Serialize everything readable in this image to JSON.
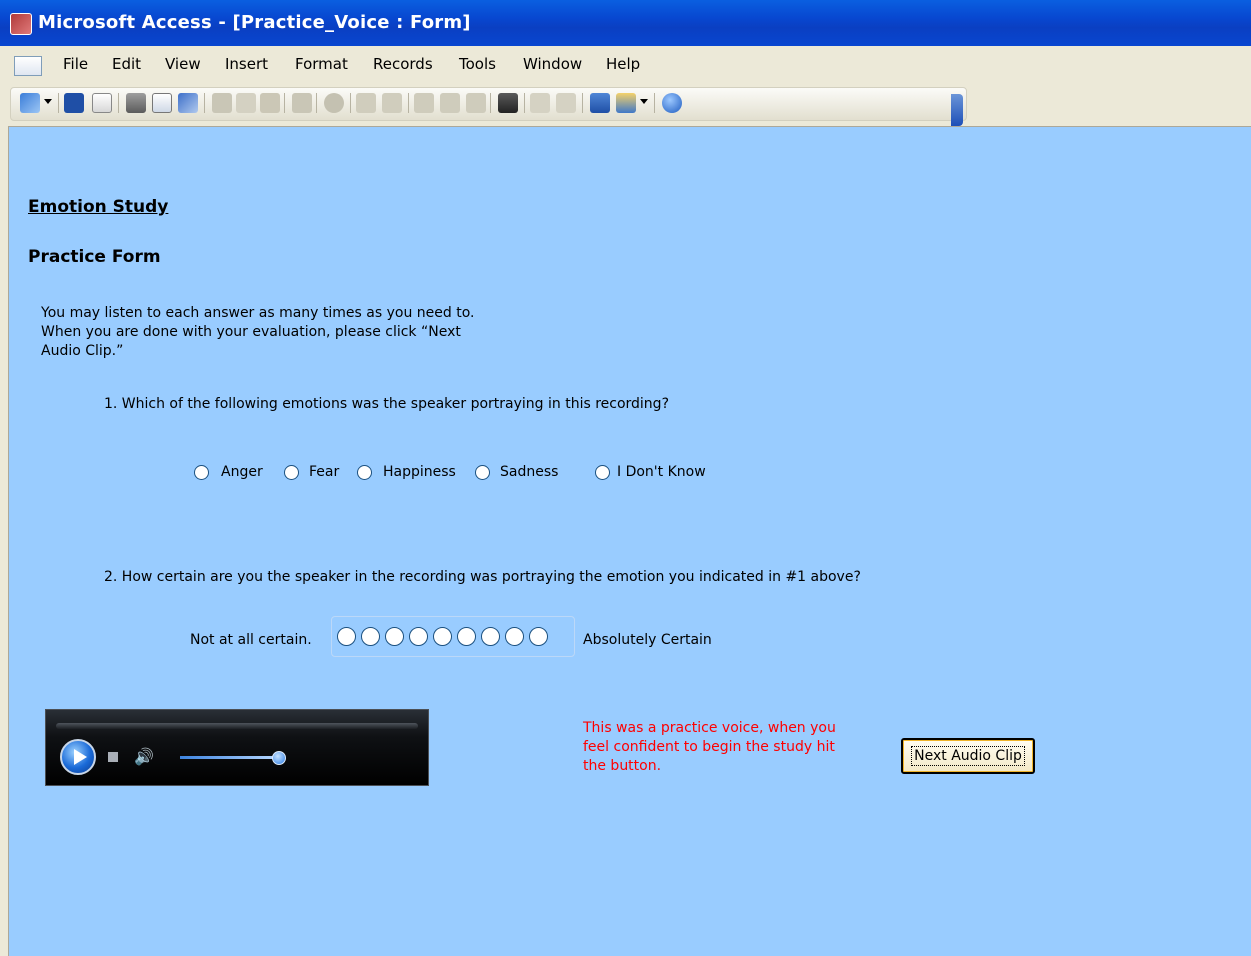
{
  "window": {
    "title": "Microsoft Access - [Practice_Voice : Form]"
  },
  "menu": {
    "items": [
      "File",
      "Edit",
      "View",
      "Insert",
      "Format",
      "Records",
      "Tools",
      "Window",
      "Help"
    ]
  },
  "toolbar": {
    "icons": [
      "design-view-icon",
      "save-icon",
      "search-icon",
      "print-icon",
      "print-preview-icon",
      "spelling-icon",
      "cut-icon",
      "copy-icon",
      "paste-icon",
      "undo-icon",
      "hyperlink-icon",
      "sort-ascending-icon",
      "sort-descending-icon",
      "filter-by-selection-icon",
      "filter-by-form-icon",
      "apply-filter-icon",
      "find-icon",
      "new-record-icon",
      "delete-record-icon",
      "database-window-icon",
      "new-object-icon",
      "help-icon"
    ]
  },
  "form": {
    "heading1": "Emotion Study",
    "heading2": "Practice Form",
    "instructions": "You may listen to each answer as many times as you need to. When you are done with your evaluation, please click “Next Audio Clip.”",
    "question1": "1. Which of the following emotions was the speaker portraying in this recording?",
    "emotion_options": [
      "Anger",
      "Fear",
      "Happiness",
      "Sadness",
      "I Don't Know"
    ],
    "question2": "2. How certain are you the speaker in the recording was portraying the emotion you indicated in #1 above?",
    "scale_low_label": "Not at all certain.",
    "scale_high_label": "Absolutely Certain",
    "scale_points": 9,
    "note": "This was a practice voice, when you feel confident to begin the study hit the button.",
    "next_button_label": "Next Audio Clip"
  },
  "colors": {
    "form_background": "#99ccff",
    "note_text": "#ff0000",
    "titlebar": "#0a3fc2"
  }
}
